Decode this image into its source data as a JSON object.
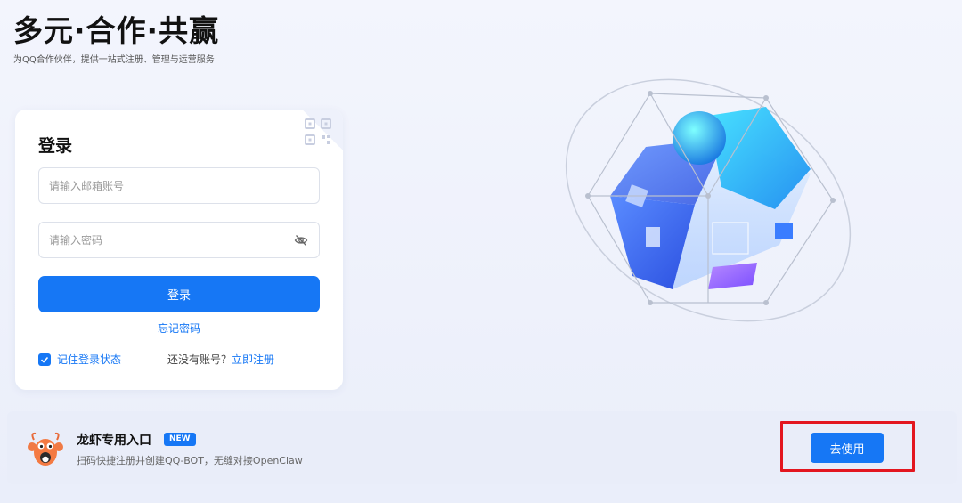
{
  "hero": {
    "title": "多元·合作·共赢",
    "subtitle": "为QQ合作伙伴，提供一站式注册、管理与运营服务"
  },
  "login": {
    "title": "登录",
    "email_placeholder": "请输入邮箱账号",
    "password_placeholder": "请输入密码",
    "submit_label": "登录",
    "forgot_label": "忘记密码",
    "remember_label": "记住登录状态",
    "remember_checked": true,
    "no_account_text": "还没有账号？",
    "register_label": "立即注册",
    "qr_icon": "qr-code-icon",
    "password_toggle_icon": "eye-off-icon"
  },
  "entry": {
    "title": "龙虾专用入口",
    "badge": "NEW",
    "description": "扫码快捷注册并创建QQ-BOT，无缝对接OpenClaw",
    "button_label": "去使用",
    "mascot_icon": "lobster-mascot-icon"
  },
  "colors": {
    "accent": "#1677f5",
    "highlight": "#e3161f",
    "background": "#eef1fb"
  }
}
